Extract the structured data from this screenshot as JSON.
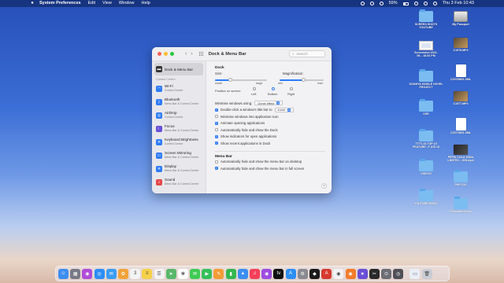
{
  "menubar": {
    "app_name": "System Preferences",
    "items": [
      "Edit",
      "View",
      "Window",
      "Help"
    ],
    "battery": "59%",
    "datetime": "Thu 3 Feb  10:43"
  },
  "window": {
    "title": "Dock & Menu Bar",
    "search_placeholder": "Search",
    "sidebar": {
      "selected": {
        "title": "Dock & Menu Bar"
      },
      "section_label": "Control Centre",
      "items": [
        {
          "title": "Wi-Fi",
          "subtitle": "Control Centre",
          "color": "#2f7cf6",
          "icon": "wifi-icon",
          "glyph": "◠"
        },
        {
          "title": "Bluetooth",
          "subtitle": "Menu Bar & Control Centre",
          "color": "#2f7cf6",
          "icon": "bluetooth-icon",
          "glyph": "ᛒ"
        },
        {
          "title": "AirDrop",
          "subtitle": "Control Centre",
          "color": "#2f7cf6",
          "icon": "airdrop-icon",
          "glyph": "◎"
        },
        {
          "title": "Focus",
          "subtitle": "Menu Bar & Control Centre",
          "color": "#6a4fd6",
          "icon": "focus-moon-icon",
          "glyph": "☾"
        },
        {
          "title": "Keyboard Brightness",
          "subtitle": "Control Centre",
          "color": "#2f7cf6",
          "icon": "keyboard-brightness-icon",
          "glyph": "☀"
        },
        {
          "title": "Screen Mirroring",
          "subtitle": "Menu Bar & Control Centre",
          "color": "#2f7cf6",
          "icon": "screen-mirroring-icon",
          "glyph": "▭"
        },
        {
          "title": "Display",
          "subtitle": "Menu Bar & Control Centre",
          "color": "#2f7cf6",
          "icon": "display-icon",
          "glyph": "☀"
        },
        {
          "title": "Sound",
          "subtitle": "Menu Bar & Control Centre",
          "color": "#e5484d",
          "icon": "sound-icon",
          "glyph": "♪"
        }
      ]
    },
    "dock_section": {
      "heading": "Dock",
      "size_label": "Size:",
      "size_small": "small",
      "size_large": "large",
      "size_value": 0.3,
      "magnification_label": "Magnification:",
      "mag_min": "min",
      "mag_max": "max",
      "magnification_value": 0.55,
      "position_label": "Position on screen:",
      "positions": [
        "Left",
        "Bottom",
        "Right"
      ],
      "selected_position": "Bottom",
      "minimise_label": "Minimise windows using:",
      "minimise_value": "Genie effect",
      "double_click_label": "Double-click a window's title bar to",
      "double_click_value": "zoom",
      "checks": [
        {
          "label": "Minimise windows into application icon",
          "checked": false
        },
        {
          "label": "Animate opening applications",
          "checked": true
        },
        {
          "label": "Automatically hide and show the Dock",
          "checked": false
        },
        {
          "label": "Show indicators for open applications",
          "checked": true
        },
        {
          "label": "Show recent applications in Dock",
          "checked": true
        }
      ]
    },
    "menubar_section": {
      "heading": "Menu Bar",
      "checks": [
        {
          "label": "Automatically hide and show the menu bar on desktop",
          "checked": false
        },
        {
          "label": "Automatically hide and show the menu bar in full screen",
          "checked": true
        }
      ]
    },
    "help_label": "?"
  },
  "desktop": {
    "col1": [
      {
        "label": "SCREEN SHOTS YOUTUBE",
        "kind": "folder"
      },
      {
        "label": "Screenshot 2021-05....18.52 PM",
        "kind": "shot"
      },
      {
        "label": "SOUMYA KINDLE NOVEL PROJECT",
        "kind": "folder"
      },
      {
        "label": "SSR",
        "kind": "folder"
      },
      {
        "label": "TTTV-15.TOP 15 FEATURE...F IOS 15",
        "kind": "folder"
      },
      {
        "label": "VIDEOS",
        "kind": "folder"
      },
      {
        "label": "YOUTUBE MUSIC",
        "kind": "folder"
      }
    ],
    "col2": [
      {
        "label": "My Passport",
        "kind": "drive"
      },
      {
        "label": "C1578.MP4",
        "kind": "video"
      },
      {
        "label": "C1576M01.XML",
        "kind": "doc"
      },
      {
        "label": "C1577.MP4",
        "kind": "video"
      },
      {
        "label": "C1577M01.XML",
        "kind": "doc"
      },
      {
        "label": "PEPSI COLA 1940s LIMITED....ION.mp4",
        "kind": "video-dark"
      },
      {
        "label": "PHOTOS",
        "kind": "folder"
      },
      {
        "label": "Relocated Items",
        "kind": "folder"
      }
    ]
  },
  "dock": {
    "apps": [
      {
        "name": "finder-icon",
        "color": "#3d8ef0",
        "glyph": "☺"
      },
      {
        "name": "launchpad-icon",
        "color": "#7a7a86",
        "glyph": "▦"
      },
      {
        "name": "siri-icon",
        "color": "#b04cd8",
        "glyph": "◉"
      },
      {
        "name": "safari-icon",
        "color": "#2c8ef4",
        "glyph": "◎"
      },
      {
        "name": "mail-icon",
        "color": "#3a9cf4",
        "glyph": "✉"
      },
      {
        "name": "photos-icon",
        "color": "#f0a33a",
        "glyph": "✿"
      },
      {
        "name": "calendar-icon",
        "color": "#f3f3f3",
        "glyph": "3"
      },
      {
        "name": "notes-icon",
        "color": "#f5d04a",
        "glyph": "≡"
      },
      {
        "name": "reminders-icon",
        "color": "#f3f3f3",
        "glyph": "☰"
      },
      {
        "name": "maps-icon",
        "color": "#59b86a",
        "glyph": "➤"
      },
      {
        "name": "photos-app-icon",
        "color": "#ffffff",
        "glyph": "✾"
      },
      {
        "name": "messages-icon",
        "color": "#3fcb55",
        "glyph": "✉"
      },
      {
        "name": "facetime-icon",
        "color": "#36c05a",
        "glyph": "▶"
      },
      {
        "name": "pages-icon",
        "color": "#f29c36",
        "glyph": "✎"
      },
      {
        "name": "numbers-icon",
        "color": "#35b750",
        "glyph": "▮"
      },
      {
        "name": "keynote-icon",
        "color": "#3a8ff0",
        "glyph": "▲"
      },
      {
        "name": "music-icon",
        "color": "#f5405a",
        "glyph": "♫"
      },
      {
        "name": "podcasts-icon",
        "color": "#9d4ce0",
        "glyph": "◉"
      },
      {
        "name": "appletv-icon",
        "color": "#111111",
        "glyph": "tv"
      },
      {
        "name": "appstore-icon",
        "color": "#2c8ef4",
        "glyph": "A"
      },
      {
        "name": "system-prefs-icon",
        "color": "#8a8a90",
        "glyph": "⚙"
      },
      {
        "name": "nvidia-icon",
        "color": "#1a1a1a",
        "glyph": "◆"
      },
      {
        "name": "acrobat-icon",
        "color": "#d63a2f",
        "glyph": "A"
      },
      {
        "name": "chrome-icon",
        "color": "#f2f2f2",
        "glyph": "◉"
      },
      {
        "name": "firefox-icon",
        "color": "#f27c2a",
        "glyph": "◉"
      },
      {
        "name": "imovie-icon",
        "color": "#6a4fd6",
        "glyph": "★"
      },
      {
        "name": "final-cut-icon",
        "color": "#2a2a2a",
        "glyph": "✂"
      },
      {
        "name": "screenshot-icon",
        "color": "#6d6d75",
        "glyph": "⊙"
      },
      {
        "name": "other-app-icon",
        "color": "#505058",
        "glyph": "◎"
      },
      {
        "name": "preview-icon",
        "color": "#e9eef7",
        "glyph": "▭"
      },
      {
        "name": "trash-icon",
        "color": "#c9ccd4",
        "glyph": "🗑"
      }
    ]
  }
}
